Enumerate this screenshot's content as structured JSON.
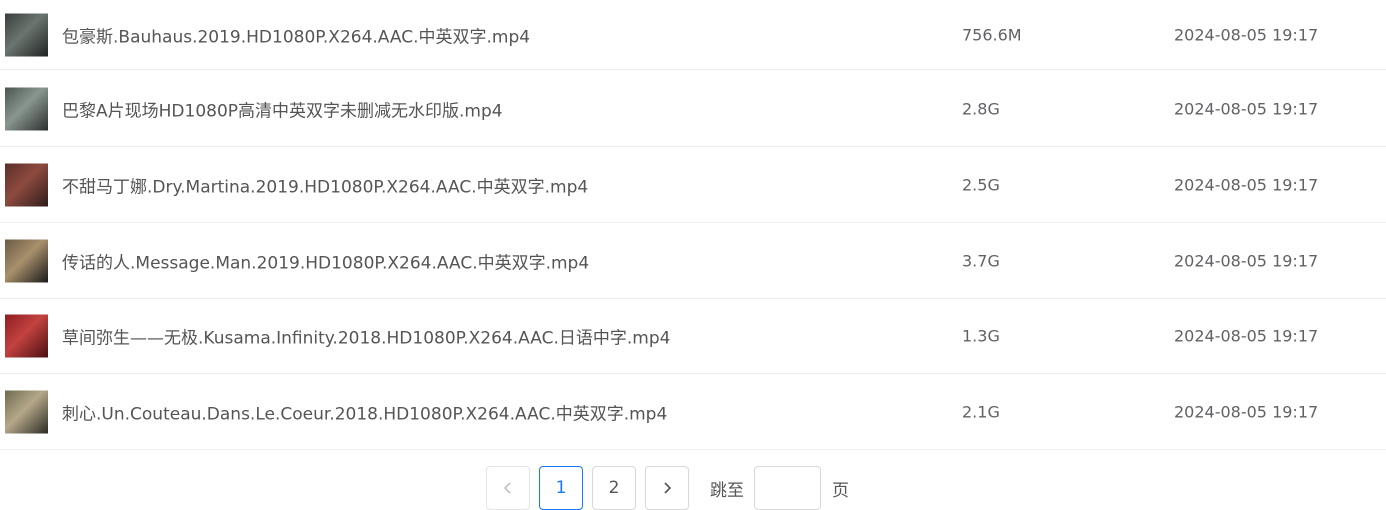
{
  "files": [
    {
      "name": "包豪斯.Bauhaus.2019.HD1080P.X264.AAC.中英双字.mp4",
      "size": "756.6M",
      "date": "2024-08-05 19:17",
      "thumb_colors": [
        "#3a3f3c",
        "#6b7570",
        "#1f2321"
      ]
    },
    {
      "name": "巴黎A片现场HD1080P高清中英双字未删减无水印版.mp4",
      "size": "2.8G",
      "date": "2024-08-05 19:17",
      "thumb_colors": [
        "#4a5550",
        "#8a9690",
        "#2a2f2d"
      ]
    },
    {
      "name": "不甜马丁娜.Dry.Martina.2019.HD1080P.X264.AAC.中英双字.mp4",
      "size": "2.5G",
      "date": "2024-08-05 19:17",
      "thumb_colors": [
        "#5a2e2a",
        "#8e4a3f",
        "#2d1d1b"
      ]
    },
    {
      "name": "传话的人.Message.Man.2019.HD1080P.X264.AAC.中英双字.mp4",
      "size": "3.7G",
      "date": "2024-08-05 19:17",
      "thumb_colors": [
        "#6b5a44",
        "#a8906c",
        "#1a1a1a"
      ]
    },
    {
      "name": "草间弥生——无极.Kusama.Infinity.2018.HD1080P.X264.AAC.日语中字.mp4",
      "size": "1.3G",
      "date": "2024-08-05 19:17",
      "thumb_colors": [
        "#8e1e22",
        "#c2423f",
        "#4a0f12"
      ]
    },
    {
      "name": "刺心.Un.Couteau.Dans.Le.Coeur.2018.HD1080P.X264.AAC.中英双字.mp4",
      "size": "2.1G",
      "date": "2024-08-05 19:17",
      "thumb_colors": [
        "#6e6a4e",
        "#b5a88a",
        "#2b2a22"
      ]
    }
  ],
  "pagination": {
    "prev_icon": "chevron-left-icon",
    "next_icon": "chevron-right-icon",
    "pages": [
      "1",
      "2"
    ],
    "current_page": "1",
    "jump_label": "跳至",
    "jump_value": "",
    "page_unit": "页",
    "accent_color": "#1677ff"
  }
}
